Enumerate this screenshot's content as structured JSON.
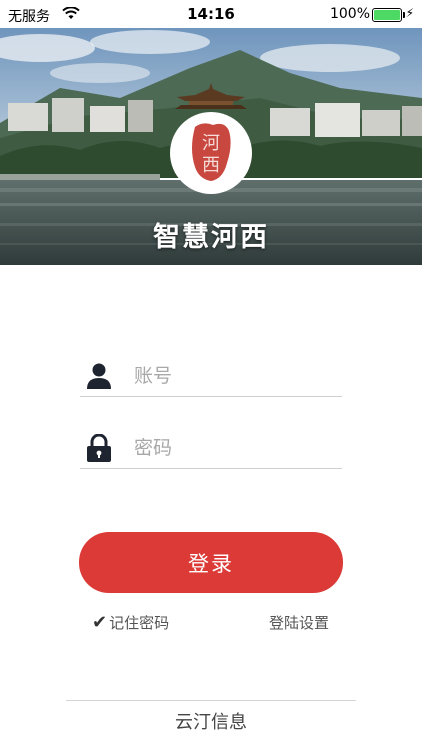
{
  "status_bar": {
    "carrier": "无服务",
    "time": "14:16",
    "battery": "100%",
    "icons": [
      "wifi-icon",
      "battery-icon",
      "charging-bolt-icon"
    ]
  },
  "header": {
    "title": "智慧河西",
    "logo_text": "河西"
  },
  "form": {
    "account_placeholder": "账号",
    "password_placeholder": "密码",
    "account_icon": "user-icon",
    "password_icon": "lock-icon"
  },
  "actions": {
    "login_label": "登录",
    "remember_label": "记住密码",
    "settings_label": "登陆设置"
  },
  "footer": {
    "company": "云汀信息"
  },
  "colors": {
    "primary": "#db3a37",
    "logo_red": "#c8473f",
    "battery_green": "#4cd964"
  }
}
